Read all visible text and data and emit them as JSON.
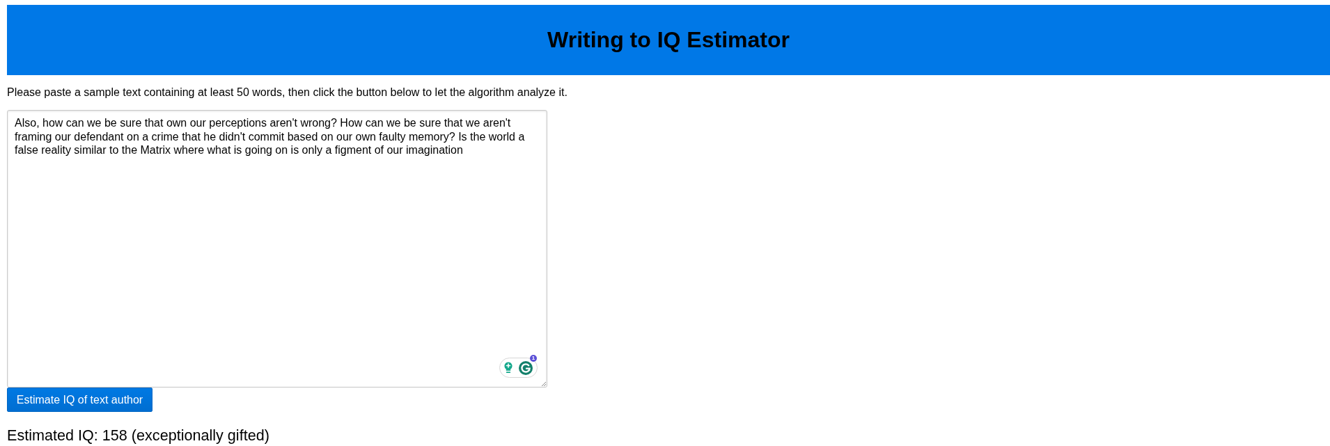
{
  "header": {
    "title": "Writing to IQ Estimator"
  },
  "instructions": "Please paste a sample text containing at least 50 words, then click the button below to let the algorithm analyze it.",
  "text_input": {
    "value": "Also, how can we be sure that own our perceptions aren't wrong? How can we be sure that we aren't framing our defendant on a crime that he didn't commit based on our own faulty memory? Is the world a false reality similar to the Matrix where what is going on is only a figment of our imagination"
  },
  "grammar_widget": {
    "badge": "1"
  },
  "button": {
    "label": "Estimate IQ of text author"
  },
  "result": "Estimated IQ: 158 (exceptionally gifted)"
}
